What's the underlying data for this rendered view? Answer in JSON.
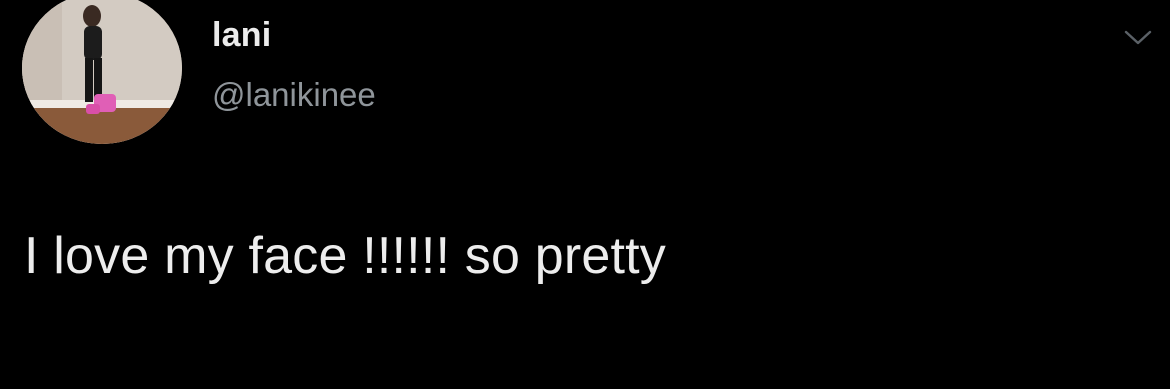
{
  "tweet": {
    "author": {
      "display_name": "lani",
      "handle": "@lanikinee",
      "avatar_icon": "profile-photo"
    },
    "more_icon": "chevron-down-icon",
    "text": "I love my face !!!!!! so pretty"
  },
  "colors": {
    "background": "#000000",
    "text_primary": "#ececec",
    "text_secondary": "#8f959a"
  }
}
